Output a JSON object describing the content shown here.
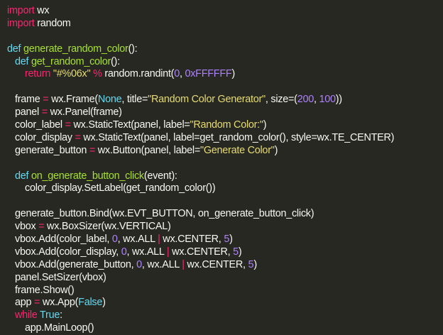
{
  "colors": {
    "background": "#272822",
    "keyword": "#f92672",
    "function_name": "#a6e22e",
    "builtin": "#66d9ef",
    "string": "#e6db74",
    "number": "#ae81ff",
    "plain": "#f8f8f2"
  },
  "code": {
    "l1": [
      "import",
      " wx"
    ],
    "l2": [
      "import",
      " random"
    ],
    "l4": [
      "def",
      " ",
      "generate_random_color",
      "():"
    ],
    "l5": [
      "def",
      " ",
      "get_random_color",
      "():"
    ],
    "l6": [
      "return",
      " ",
      "\"#%06x\"",
      " ",
      "%",
      " random.randint(",
      "0",
      ", ",
      "0xFFFFFF",
      ")"
    ],
    "l8": [
      "frame ",
      "=",
      " wx.Frame(",
      "None",
      ", title=",
      "\"Random Color Generator\"",
      ", size=(",
      "200",
      ", ",
      "100",
      "))"
    ],
    "l9": [
      "panel ",
      "=",
      " wx.Panel(frame)"
    ],
    "l10": [
      "color_label ",
      "=",
      " wx.StaticText(panel, label=",
      "\"Random Color:\"",
      ")"
    ],
    "l11": [
      "color_display ",
      "=",
      " wx.StaticText(panel, label=get_random_color(), style=wx.TE_CENTER)"
    ],
    "l12": [
      "generate_button ",
      "=",
      " wx.Button(panel, label=",
      "\"Generate Color\"",
      ")"
    ],
    "l14": [
      "def",
      " ",
      "on_generate_button_click",
      "(event):"
    ],
    "l15": [
      "color_display.SetLabel(get_random_color())"
    ],
    "l17": [
      "generate_button.Bind(wx.EVT_BUTTON, on_generate_button_click)"
    ],
    "l18": [
      "vbox ",
      "=",
      " wx.BoxSizer(wx.VERTICAL)"
    ],
    "l19": [
      "vbox.Add(color_label, ",
      "0",
      ", wx.ALL ",
      "|",
      " wx.CENTER, ",
      "5",
      ")"
    ],
    "l20": [
      "vbox.Add(color_display, ",
      "0",
      ", wx.ALL ",
      "|",
      " wx.CENTER, ",
      "5",
      ")"
    ],
    "l21": [
      "vbox.Add(generate_button, ",
      "0",
      ", wx.ALL ",
      "|",
      " wx.CENTER, ",
      "5",
      ")"
    ],
    "l22": [
      "panel.SetSizer(vbox)"
    ],
    "l23": [
      "frame.Show()"
    ],
    "l24": [
      "app ",
      "=",
      " wx.App(",
      "False",
      ")"
    ],
    "l25": [
      "while",
      " ",
      "True",
      ":"
    ],
    "l26": [
      "app.MainLoop()"
    ]
  }
}
